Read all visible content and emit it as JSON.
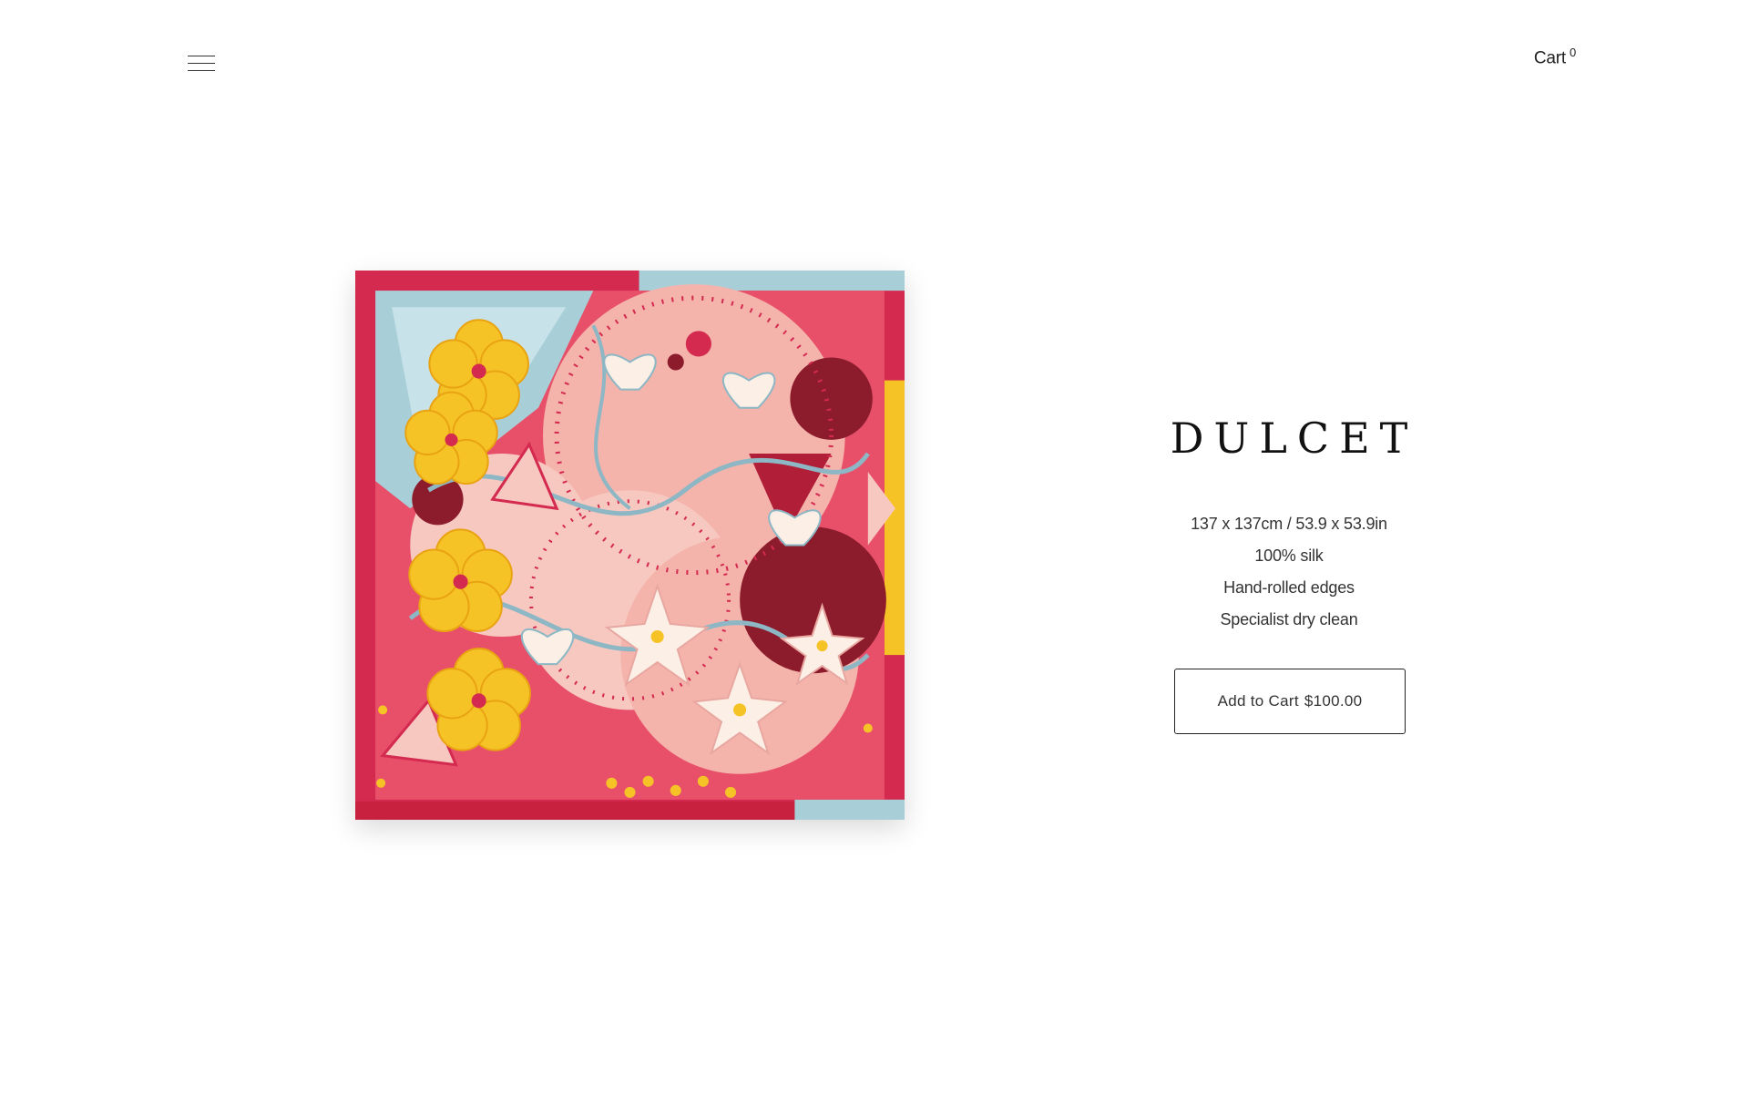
{
  "header": {
    "menu_icon": "hamburger-menu-icon",
    "cart_label": "Cart",
    "cart_count": "0"
  },
  "product": {
    "title": "DULCET",
    "image_description_icon": "scarf-pattern-image",
    "specs": [
      "137 x 137cm / 53.9 x 53.9in",
      "100% silk",
      "Hand-rolled edges",
      "Specialist dry clean"
    ],
    "add_to_cart_label": "Add to Cart",
    "price": "$100.00"
  },
  "colors": {
    "background": "#ffffff",
    "text": "#222222",
    "scarf_red": "#d42a4f",
    "scarf_pink": "#f4b3ab",
    "scarf_yellow": "#f6c327",
    "scarf_blue": "#a8cfd8",
    "scarf_maroon": "#8c1c2c"
  }
}
